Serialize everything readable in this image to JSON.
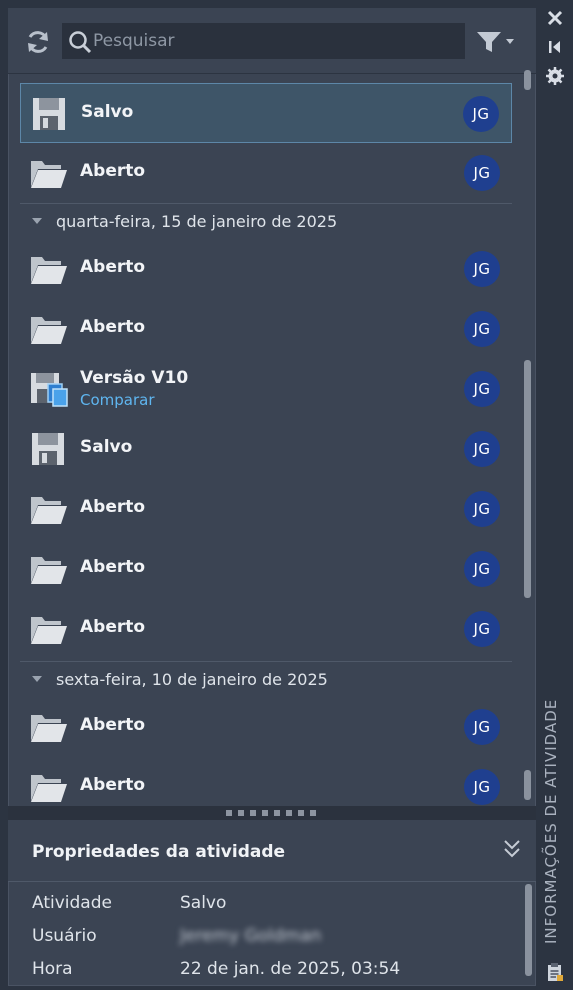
{
  "search": {
    "placeholder": "Pesquisar"
  },
  "list": {
    "rows_top": [
      {
        "icon": "save-icon",
        "label": "Salvo",
        "avatar": "JG",
        "selected": true
      },
      {
        "icon": "folder-open-icon",
        "label": "Aberto",
        "avatar": "JG"
      }
    ],
    "group1": {
      "date": "quarta-feira, 15 de janeiro de 2025",
      "rows": [
        {
          "icon": "folder-open-icon",
          "label": "Aberto",
          "avatar": "JG"
        },
        {
          "icon": "folder-open-icon",
          "label": "Aberto",
          "avatar": "JG"
        },
        {
          "icon": "version-icon",
          "label": "Versão V10",
          "sub": "Comparar",
          "avatar": "JG"
        },
        {
          "icon": "save-icon",
          "label": "Salvo",
          "avatar": "JG"
        },
        {
          "icon": "folder-open-icon",
          "label": "Aberto",
          "avatar": "JG"
        },
        {
          "icon": "folder-open-icon",
          "label": "Aberto",
          "avatar": "JG"
        },
        {
          "icon": "folder-open-icon",
          "label": "Aberto",
          "avatar": "JG"
        }
      ]
    },
    "group2": {
      "date": "sexta-feira, 10 de janeiro de 2025",
      "rows": [
        {
          "icon": "folder-open-icon",
          "label": "Aberto",
          "avatar": "JG"
        },
        {
          "icon": "folder-open-icon",
          "label": "Aberto",
          "avatar": "JG"
        }
      ]
    }
  },
  "properties": {
    "title": "Propriedades da atividade",
    "rows": [
      {
        "key": "Atividade",
        "value": "Salvo"
      },
      {
        "key": "Usuário",
        "value": "Jeremy Goldman"
      },
      {
        "key": "Hora",
        "value": "22 de jan. de 2025, 03:54"
      }
    ]
  },
  "side_panel": {
    "label": "INFORMAÇÕES DE ATIVIDADE"
  },
  "colors": {
    "accent": "#5fb6f0",
    "avatar_bg": "#1f3f8f",
    "selected_bg": "#3e5568"
  }
}
